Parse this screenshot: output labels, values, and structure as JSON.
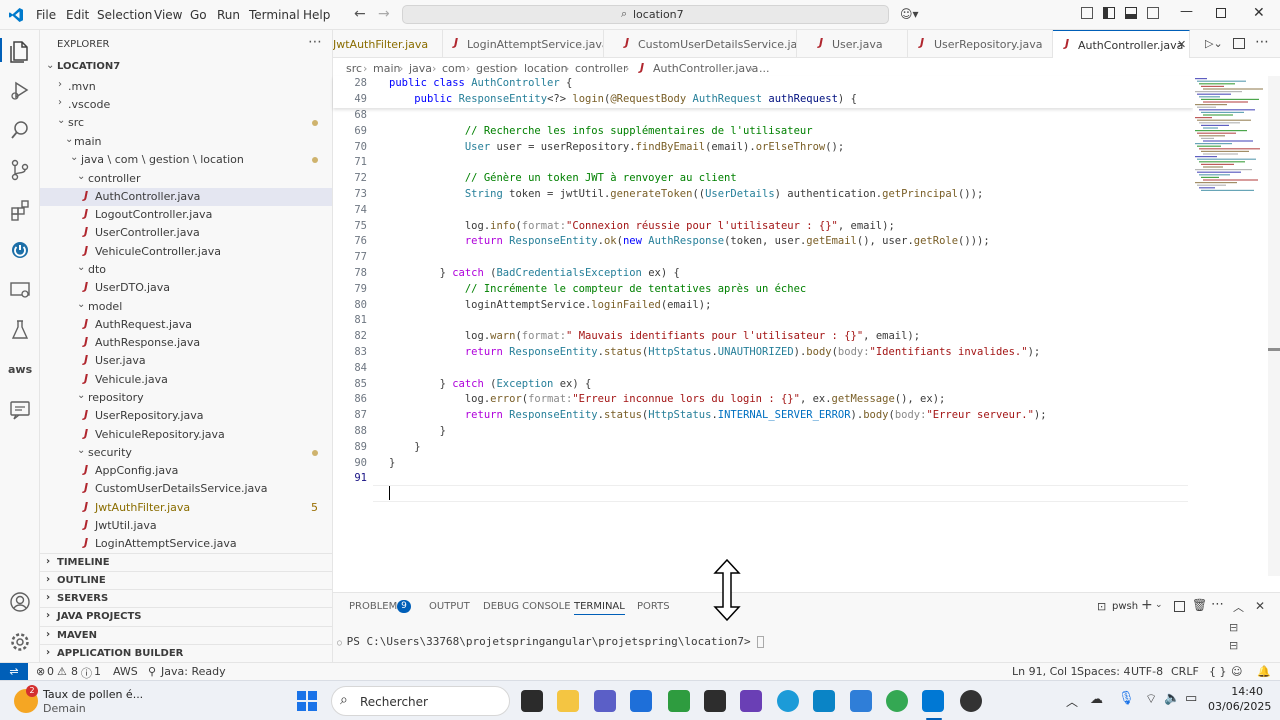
{
  "titlebar": {
    "menus": [
      "File",
      "Edit",
      "Selection",
      "View",
      "Go",
      "Run",
      "Terminal",
      "Help"
    ],
    "command_center": "location7"
  },
  "explorer": {
    "header": "EXPLORER",
    "root": "LOCATION7",
    "items": [
      {
        "label": ".mvn",
        "kind": "folder",
        "open": false
      },
      {
        "label": ".vscode",
        "kind": "folder",
        "open": false
      },
      {
        "label": "src",
        "kind": "folder",
        "open": true
      },
      {
        "label": "main",
        "kind": "folder",
        "open": true
      },
      {
        "label": "java \\ com \\ gestion \\ location",
        "kind": "folder",
        "open": true
      },
      {
        "label": "controller",
        "kind": "folder",
        "open": true
      },
      {
        "label": "AuthController.java",
        "kind": "file"
      },
      {
        "label": "LogoutController.java",
        "kind": "file"
      },
      {
        "label": "UserController.java",
        "kind": "file"
      },
      {
        "label": "VehiculeController.java",
        "kind": "file"
      },
      {
        "label": "dto",
        "kind": "folder",
        "open": true
      },
      {
        "label": "UserDTO.java",
        "kind": "file"
      },
      {
        "label": "model",
        "kind": "folder",
        "open": true
      },
      {
        "label": "AuthRequest.java",
        "kind": "file"
      },
      {
        "label": "AuthResponse.java",
        "kind": "file"
      },
      {
        "label": "User.java",
        "kind": "file"
      },
      {
        "label": "Vehicule.java",
        "kind": "file"
      },
      {
        "label": "repository",
        "kind": "folder",
        "open": true
      },
      {
        "label": "UserRepository.java",
        "kind": "file"
      },
      {
        "label": "VehiculeRepository.java",
        "kind": "file"
      },
      {
        "label": "security",
        "kind": "folder",
        "open": true
      },
      {
        "label": "AppConfig.java",
        "kind": "file"
      },
      {
        "label": "CustomUserDetailsService.java",
        "kind": "file"
      },
      {
        "label": "JwtAuthFilter.java",
        "kind": "file",
        "badge": "5"
      },
      {
        "label": "JwtUtil.java",
        "kind": "file"
      },
      {
        "label": "LoginAttemptService.java",
        "kind": "file"
      }
    ],
    "sections": [
      "TIMELINE",
      "OUTLINE",
      "SERVERS",
      "JAVA PROJECTS",
      "MAVEN",
      "APPLICATION BUILDER"
    ]
  },
  "tabs": [
    {
      "label": "JwtAuthFilter.java",
      "badge": "5"
    },
    {
      "label": "LoginAttemptService.java"
    },
    {
      "label": "CustomUserDetailsService.java"
    },
    {
      "label": "User.java"
    },
    {
      "label": "UserRepository.java"
    },
    {
      "label": "AuthController.java",
      "active": true
    }
  ],
  "breadcrumb": [
    "src",
    "main",
    "java",
    "com",
    "gestion",
    "location",
    "controller",
    "AuthController.java",
    "..."
  ],
  "sticky": [
    {
      "ln": "28",
      "text": "public class AuthController {"
    },
    {
      "ln": "49",
      "text": "    public ResponseEntity<?> login(@RequestBody AuthRequest authRequest) {"
    }
  ],
  "code_lines": [
    {
      "ln": "68",
      "text": ""
    },
    {
      "ln": "69",
      "text": "            // Recherche les infos supplémentaires de l'utilisateur"
    },
    {
      "ln": "70",
      "text": "            User user = userRepository.findByEmail(email).orElseThrow();"
    },
    {
      "ln": "71",
      "text": ""
    },
    {
      "ln": "72",
      "text": "            // Génère un token JWT à renvoyer au client"
    },
    {
      "ln": "73",
      "text": "            String token = jwtUtil.generateToken((UserDetails) authentication.getPrincipal());"
    },
    {
      "ln": "74",
      "text": ""
    },
    {
      "ln": "75",
      "text": "            log.info(format:\"Connexion réussie pour l'utilisateur : {}\", email);"
    },
    {
      "ln": "76",
      "text": "            return ResponseEntity.ok(new AuthResponse(token, user.getEmail(), user.getRole()));"
    },
    {
      "ln": "77",
      "text": ""
    },
    {
      "ln": "78",
      "text": "        } catch (BadCredentialsException ex) {"
    },
    {
      "ln": "79",
      "text": "            // Incrémente le compteur de tentatives après un échec"
    },
    {
      "ln": "80",
      "text": "            loginAttemptService.loginFailed(email);"
    },
    {
      "ln": "81",
      "text": ""
    },
    {
      "ln": "82",
      "text": "            log.warn(format:\" Mauvais identifiants pour l'utilisateur : {}\", email);"
    },
    {
      "ln": "83",
      "text": "            return ResponseEntity.status(HttpStatus.UNAUTHORIZED).body(body:\"Identifiants invalides.\");"
    },
    {
      "ln": "84",
      "text": ""
    },
    {
      "ln": "85",
      "text": "        } catch (Exception ex) {"
    },
    {
      "ln": "86",
      "text": "            log.error(format:\"Erreur inconnue lors du login : {}\", ex.getMessage(), ex);"
    },
    {
      "ln": "87",
      "text": "            return ResponseEntity.status(HttpStatus.INTERNAL_SERVER_ERROR).body(body:\"Erreur serveur.\");"
    },
    {
      "ln": "88",
      "text": "        }"
    },
    {
      "ln": "89",
      "text": "    }"
    },
    {
      "ln": "90",
      "text": "}"
    },
    {
      "ln": "91",
      "text": ""
    }
  ],
  "panel": {
    "tabs": [
      "PROBLEMS",
      "OUTPUT",
      "DEBUG CONSOLE",
      "TERMINAL",
      "PORTS"
    ],
    "problems_count": "9",
    "active_tab": "TERMINAL",
    "shell": "pwsh",
    "prompt": "PS C:\\Users\\33768\\projetspringangular\\projetspring\\location7>"
  },
  "status": {
    "errors": "0",
    "warnings": "8",
    "info": "1",
    "aws": "AWS",
    "java": "Java: Ready",
    "position": "Ln 91, Col 1",
    "spaces": "Spaces: 4",
    "encoding": "UTF-8",
    "eol": "CRLF"
  },
  "taskbar": {
    "weather_title": "Taux de pollen é...",
    "weather_sub": "Demain",
    "weather_badge": "2",
    "search_placeholder": "Rechercher",
    "time": "14:40",
    "date": "03/06/2025"
  },
  "colors": {
    "accent": "#005fb8",
    "keyword": "#0000ff",
    "string": "#a31515",
    "comment": "#008000",
    "type": "#267f99"
  }
}
